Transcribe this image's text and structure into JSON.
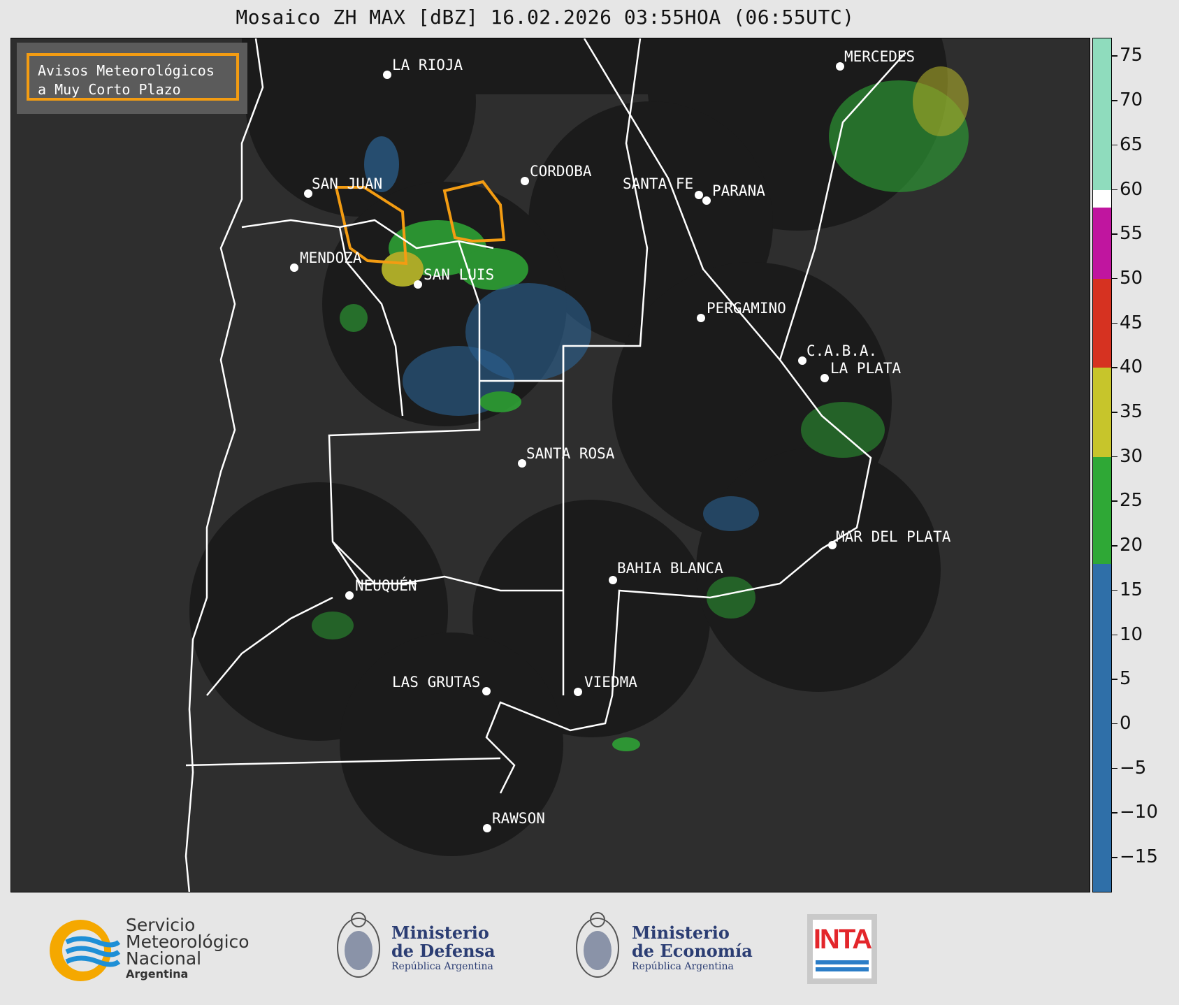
{
  "title": "Mosaico ZH MAX [dBZ] 16.02.2026 03:55HOA (06:55UTC)",
  "legend_box": {
    "line1": "Avisos Meteorológicos",
    "line2": "a Muy Corto Plazo",
    "border_color": "#f39c12"
  },
  "cities": [
    "LA RIOJA",
    "MERCEDES",
    "SAN JUAN",
    "CORDOBA",
    "SANTA FE",
    "PARANA",
    "MENDOZA",
    "SAN LUIS",
    "PERGAMINO",
    "C.A.B.A.",
    "LA PLATA",
    "SANTA ROSA",
    "MAR DEL PLATA",
    "BAHIA BLANCA",
    "NEUQUÉN",
    "LAS GRUTAS",
    "VIEDMA",
    "RAWSON"
  ],
  "colorbar": {
    "unit": "dBZ",
    "range": [
      -19,
      77
    ],
    "tick_labels": [
      "75",
      "70",
      "65",
      "60",
      "55",
      "50",
      "45",
      "40",
      "35",
      "30",
      "25",
      "20",
      "15",
      "10",
      "5",
      "0",
      "−5",
      "−10",
      "−15"
    ],
    "tick_values": [
      75,
      70,
      65,
      60,
      55,
      50,
      45,
      40,
      35,
      30,
      25,
      20,
      15,
      10,
      5,
      0,
      -5,
      -10,
      -15
    ],
    "bands": [
      {
        "from": -19,
        "to": 18,
        "color": "#2f6fa8"
      },
      {
        "from": 18,
        "to": 30,
        "color": "#2fa836"
      },
      {
        "from": 30,
        "to": 40,
        "color": "#c7c52b"
      },
      {
        "from": 40,
        "to": 50,
        "color": "#d63221"
      },
      {
        "from": 50,
        "to": 58,
        "color": "#c0159f"
      },
      {
        "from": 58,
        "to": 60,
        "color": "#ffffff"
      },
      {
        "from": 60,
        "to": 77,
        "color": "#8fdcbd"
      }
    ]
  },
  "footer": {
    "smn": {
      "line1": "Servicio",
      "line2": "Meteorológico",
      "line3": "Nacional",
      "line4": "Argentina"
    },
    "defensa": {
      "line1": "Ministerio",
      "line2": "de Defensa",
      "line3": "República Argentina"
    },
    "economia": {
      "line1": "Ministerio",
      "line2": "de Economía",
      "line3": "República Argentina"
    },
    "inta": {
      "text": "INTA"
    }
  },
  "colors": {
    "radar_bg": "#1b1b1b",
    "map_bg": "#2e2e2e",
    "boundary": "#ffffff",
    "inta_red": "#e3262b",
    "inta_blue": "#2b7dc7",
    "smn_yellow": "#f5a800",
    "smn_blue": "#1e8fd6"
  }
}
